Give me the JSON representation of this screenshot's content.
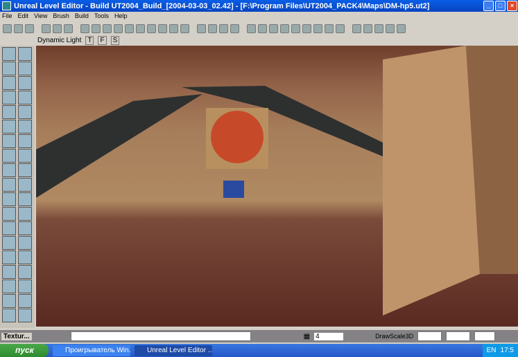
{
  "window": {
    "title": "Unreal Level Editor - Build UT2004_Build_[2004-03-03_02.42] - [F:\\Program Files\\UT2004_PACK4\\Maps\\DM-hp5.ut2]"
  },
  "menu": [
    "File",
    "Edit",
    "View",
    "Brush",
    "Build",
    "Tools",
    "Help"
  ],
  "viewport": {
    "mode": "Dynamic Light",
    "buttons": [
      "T",
      "F",
      "S"
    ]
  },
  "status": {
    "browser": "Textur...",
    "grid_value": "4",
    "drag_label": "DrawScale3D"
  },
  "taskbar": {
    "start": "пуск",
    "tasks": [
      "Проигрыватель Win...",
      "Unreal Level Editor ..."
    ],
    "lang": "EN",
    "time": "17:5"
  }
}
